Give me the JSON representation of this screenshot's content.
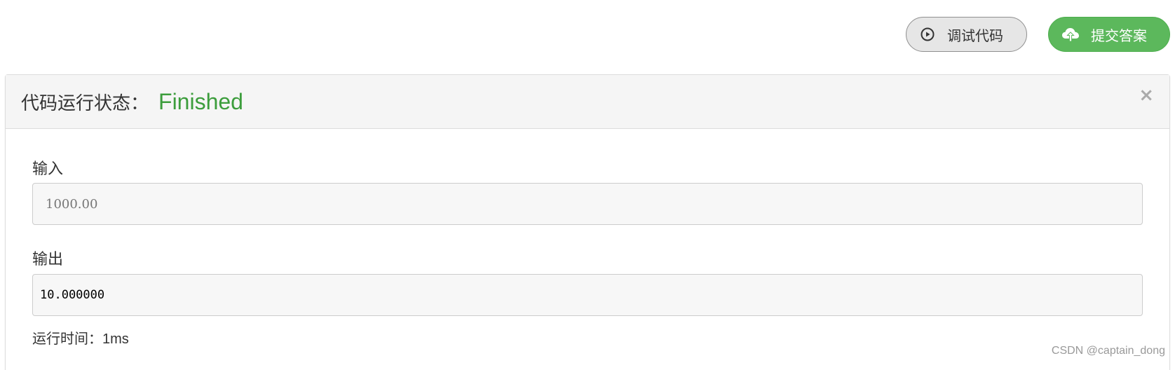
{
  "toolbar": {
    "debug_label": "调试代码",
    "debug_icon": "play-circle-icon",
    "submit_label": "提交答案",
    "submit_icon": "cloud-upload-icon",
    "submit_color": "#5cb85c"
  },
  "panel": {
    "status_label": "代码运行状态：",
    "status_value": "Finished",
    "status_color": "#3c9d3c",
    "close_symbol": "×",
    "input_label": "输入",
    "input_value": "1000.00",
    "output_label": "输出",
    "output_value": "10.000000",
    "runtime_label": "运行时间：",
    "runtime_value": "1ms"
  },
  "watermark": "CSDN @captain_dong"
}
